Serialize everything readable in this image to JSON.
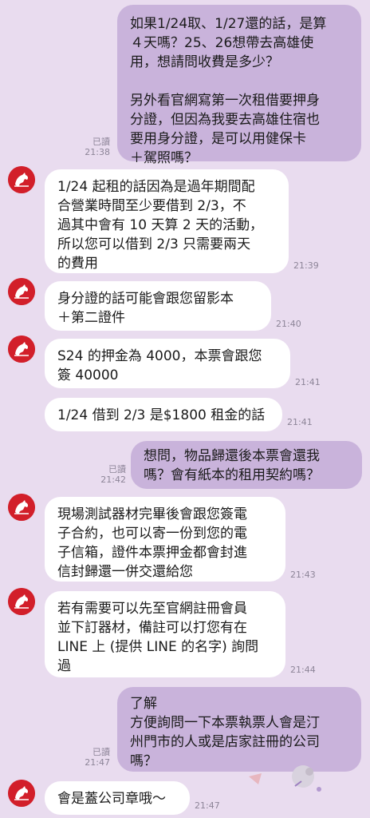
{
  "messages": [
    {
      "from": "me",
      "text": "如果1/24取、1/27還的話，是算\n４天嗎？25、26想帶去高雄使\n用，想請問收費是多少？\n\n另外看官網寫第一次租借要押身\n分證，但因為我要去高雄住宿也\n要用身分證，是可以用健保卡\n＋駕照嗎？",
      "read": "已讀",
      "time": "21:38"
    },
    {
      "from": "them",
      "text": "1/24 起租的話因為是過年期間配\n合營業時間至少要借到 2/3，不\n過其中會有 10 天算 2 天的活動，\n所以您可以借到 2/3 只需要兩天\n的費用",
      "time": "21:39"
    },
    {
      "from": "them",
      "text": "身分證的話可能會跟您留影本\n＋第二證件",
      "time": "21:40"
    },
    {
      "from": "them",
      "text": "S24 的押金為 4000，本票會跟您\n簽 40000",
      "time": "21:41"
    },
    {
      "from": "them",
      "text": "1/24 借到 2/3 是$1800 租金的話",
      "time": "21:41"
    },
    {
      "from": "me",
      "text": "想問，物品歸還後本票會還我\n嗎？會有紙本的租用契約嗎？",
      "read": "已讀",
      "time": "21:42"
    },
    {
      "from": "them",
      "text": "現場測試器材完畢後會跟您簽電\n子合約，也可以寄一份到您的電\n子信箱，證件本票押金都會封進\n信封歸還一併交還給您",
      "time": "21:43"
    },
    {
      "from": "them",
      "text": "若有需要可以先至官網註冊會員\n並下訂器材，備註可以打您有在\nLINE 上 (提供 LINE 的名字) 詢問\n過",
      "time": "21:44"
    },
    {
      "from": "me",
      "text": "了解\n方便詢問一下本票執票人會是汀\n州門市的人或是店家註冊的公司\n嗎？",
      "read": "已讀",
      "time": "21:47"
    },
    {
      "from": "them",
      "text": "會是蓋公司章哦～",
      "time": "21:47"
    }
  ]
}
